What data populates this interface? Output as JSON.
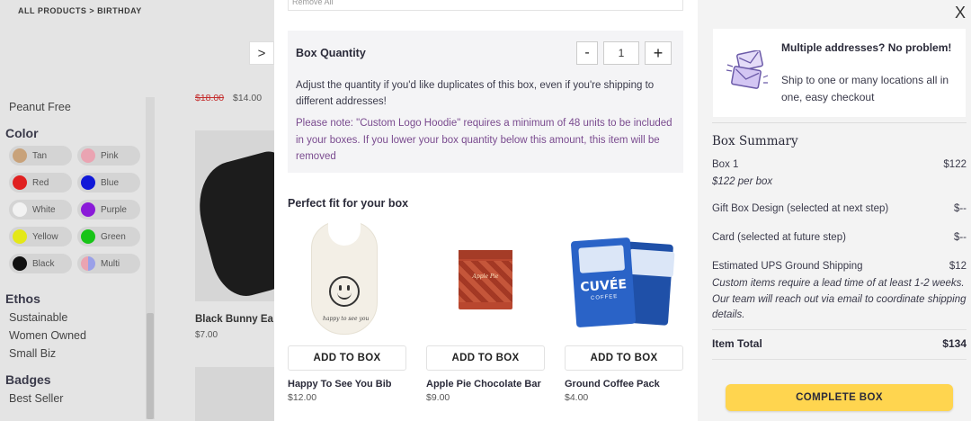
{
  "background": {
    "breadcrumb": "ALL PRODUCTS > BIRTHDAY",
    "filters": {
      "top_item": "Peanut Free",
      "color_heading": "Color",
      "colors": [
        {
          "label": "Tan",
          "hex": "#c8a27a"
        },
        {
          "label": "Pink",
          "hex": "#eaa4b2"
        },
        {
          "label": "Red",
          "hex": "#e02020"
        },
        {
          "label": "Blue",
          "hex": "#1018d8"
        },
        {
          "label": "White",
          "hex": "#f2f2f2"
        },
        {
          "label": "Purple",
          "hex": "#8a1ad8"
        },
        {
          "label": "Yellow",
          "hex": "#e4e818"
        },
        {
          "label": "Green",
          "hex": "#18c418"
        },
        {
          "label": "Black",
          "hex": "#111111"
        },
        {
          "label": "Multi",
          "hex": "#c9a0d8"
        }
      ],
      "ethos_heading": "Ethos",
      "ethos": [
        "Sustainable",
        "Women Owned",
        "Small Biz"
      ],
      "badges_heading": "Badges",
      "badges": [
        "Best Seller"
      ]
    },
    "product": {
      "old_price": "$18.00",
      "new_price": "$14.00",
      "name": "Black Bunny Ea",
      "price": "$7.00"
    },
    "next_arrow": ">"
  },
  "panel": {
    "remove_all": "Remove All",
    "quantity": {
      "title": "Box Quantity",
      "minus": "-",
      "value": "1",
      "plus": "+",
      "description": "Adjust the quantity if you'd like duplicates of this box, even if you're shipping to different addresses!",
      "note": "Please note: \"Custom Logo Hoodie\" requires a minimum of 48 units to be included in your boxes. If you lower your box quantity below this amount, this item will be removed"
    },
    "fit": {
      "title": "Perfect fit for your box",
      "add_label": "ADD TO BOX",
      "items": [
        {
          "name": "Happy To See You Bib",
          "price": "$12.00",
          "print": "happy to see you"
        },
        {
          "name": "Apple Pie Chocolate Bar",
          "price": "$9.00",
          "print": "Apple Pie"
        },
        {
          "name": "Ground Coffee Pack",
          "price": "$4.00",
          "print": "CUVÉE",
          "print2": "COFFEE"
        }
      ]
    }
  },
  "summary": {
    "close": "X",
    "promo": {
      "title": "Multiple addresses? No problem!",
      "text": "Ship to one or many locations all in one, easy checkout"
    },
    "title": "Box Summary",
    "box_label": "Box 1",
    "box_amount": "$122",
    "box_sub": "$122 per box",
    "gift_label": "Gift Box Design (selected at next step)",
    "gift_amount": "$--",
    "card_label": "Card (selected at future step)",
    "card_amount": "$--",
    "ship_label": "Estimated UPS Ground Shipping",
    "ship_amount": "$12",
    "ship_note": "Custom items require a lead time of at least 1-2 weeks. Our team will reach out via email to coordinate shipping details.",
    "total_label": "Item Total",
    "total_amount": "$134",
    "complete_label": "COMPLETE BOX"
  }
}
